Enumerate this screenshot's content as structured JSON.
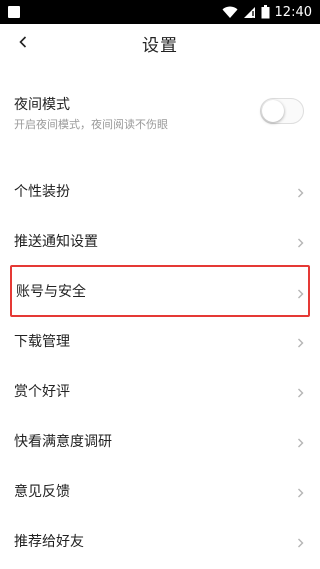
{
  "status_bar": {
    "time": "12:40"
  },
  "header": {
    "title": "设置"
  },
  "night_mode": {
    "title": "夜间模式",
    "subtitle": "开启夜间模式，夜间阅读不伤眼",
    "enabled": false
  },
  "menu": {
    "items": [
      {
        "label": "个性装扮"
      },
      {
        "label": "推送通知设置"
      },
      {
        "label": "账号与安全",
        "highlighted": true
      },
      {
        "label": "下载管理"
      },
      {
        "label": "赏个好评"
      },
      {
        "label": "快看满意度调研"
      },
      {
        "label": "意见反馈"
      },
      {
        "label": "推荐给好友"
      }
    ]
  },
  "colors": {
    "highlight_border": "#e53935",
    "status_bar_bg": "#000000"
  }
}
